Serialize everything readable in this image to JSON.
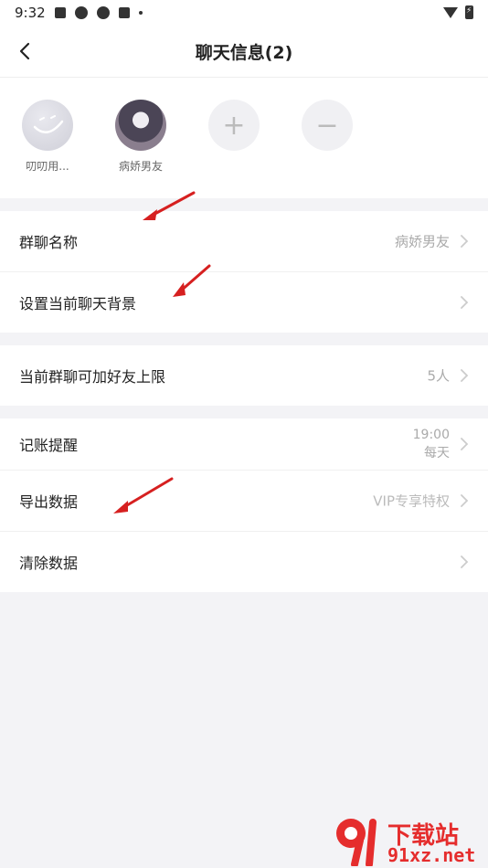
{
  "status_bar": {
    "time": "9:32"
  },
  "header": {
    "title": "聊天信息(2)"
  },
  "members": [
    {
      "name": "叨叨用..."
    },
    {
      "name": "病娇男友"
    }
  ],
  "settings": {
    "group1": [
      {
        "label": "群聊名称",
        "value": "病娇男友"
      },
      {
        "label": "设置当前聊天背景",
        "value": ""
      }
    ],
    "group2": [
      {
        "label": "当前群聊可加好友上限",
        "value": "5人"
      }
    ],
    "group3": [
      {
        "label": "记账提醒",
        "value_line1": "19:00",
        "value_line2": "每天"
      },
      {
        "label": "导出数据",
        "value": "VIP专享特权"
      },
      {
        "label": "清除数据",
        "value": ""
      }
    ]
  },
  "watermark": {
    "brand": "下载站",
    "url": "91xz.net"
  },
  "colors": {
    "annotation_arrow": "#d62020",
    "watermark": "#e52d2d"
  }
}
